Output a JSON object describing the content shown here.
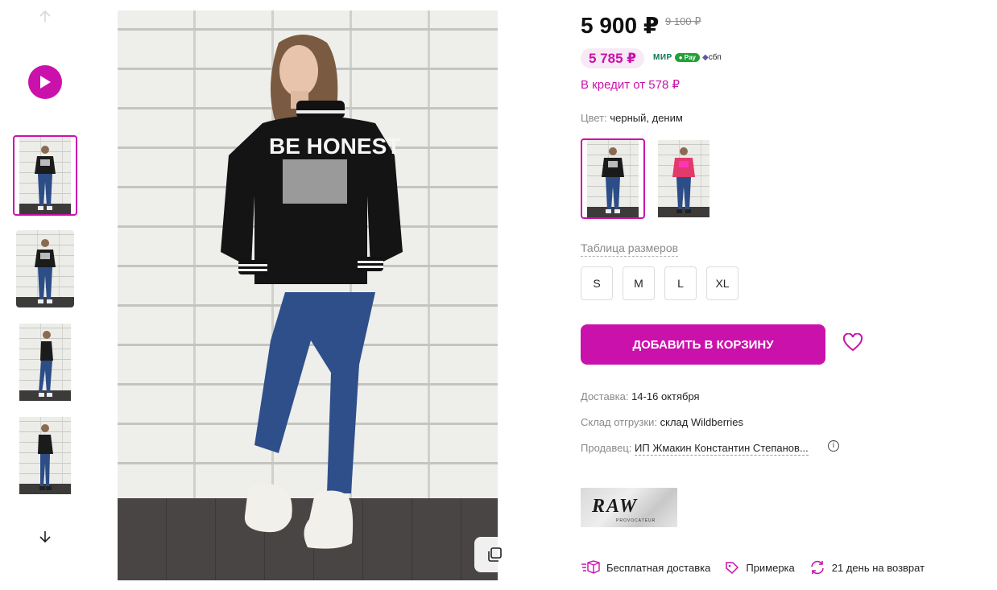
{
  "colors": {
    "accent": "#cb11ab",
    "wallet_bg": "#f7e9f6",
    "muted": "#8a8a8a",
    "text": "#242424"
  },
  "rail": {
    "up_icon": "arrow-up-icon",
    "video_icon": "play-icon",
    "down_icon": "arrow-down-icon",
    "thumbnails": [
      {
        "active": true,
        "variant": "front"
      },
      {
        "active": false,
        "variant": "front-wide"
      },
      {
        "active": false,
        "variant": "side"
      },
      {
        "active": false,
        "variant": "side-2"
      }
    ]
  },
  "product": {
    "price": "5 900 ₽",
    "old_price": "9 100 ₽",
    "wallet_price": "5 785 ₽",
    "pay_logos": {
      "mir": "МИР",
      "spay": "Pay",
      "sbp": "сбп"
    },
    "credit": "В кредит от 578 ₽",
    "color_label": "Цвет:",
    "color_value": "черный, деним",
    "swatches": [
      {
        "active": true,
        "sweater_color": "#1a1a1a"
      },
      {
        "active": false,
        "sweater_color": "#e23a6a"
      }
    ],
    "size_table_link": "Таблица размеров",
    "sizes": [
      "S",
      "M",
      "L",
      "XL"
    ],
    "add_to_cart": "ДОБАВИТЬ В КОРЗИНУ",
    "favorite_icon": "heart-icon",
    "delivery_label": "Доставка:",
    "delivery_value": "14-16 октября",
    "warehouse_label": "Склад отгрузки:",
    "warehouse_value": "склад Wildberries",
    "seller_label": "Продавец:",
    "seller_value": "ИП Жмакин Константин Степанов...",
    "brand_logo_text": "RAW",
    "brand_logo_sub": "PROVOCATEUR",
    "features": [
      {
        "icon": "box-icon",
        "label": "Бесплатная доставка"
      },
      {
        "icon": "tag-icon",
        "label": "Примерка"
      },
      {
        "icon": "return-icon",
        "label": "21 день на возврат"
      }
    ]
  },
  "main_image": {
    "sweater_print": "BE HONEST"
  }
}
